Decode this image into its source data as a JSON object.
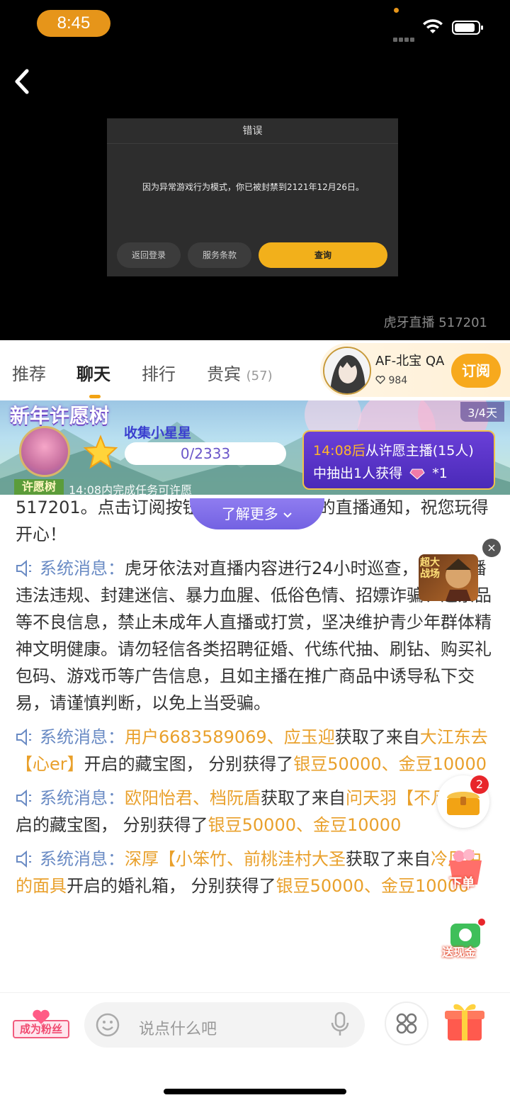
{
  "status_bar": {
    "time": "8:45"
  },
  "dialog": {
    "title": "错误",
    "message": "因为异常游戏行为模式，你已被封禁到2121年12月26日。",
    "buttons": {
      "back_login": "返回登录",
      "terms": "服务条款",
      "query": "查询"
    },
    "accent": "#f2b01b"
  },
  "video": {
    "watermark": "虎牙直播 517201"
  },
  "tabs": [
    {
      "label": "推荐"
    },
    {
      "label": "聊天"
    },
    {
      "label": "排行"
    },
    {
      "label": "贵宾",
      "count": "(57)"
    }
  ],
  "anchor": {
    "name": "AF-北宝 QA",
    "fans": "984",
    "subscribe_label": "订阅"
  },
  "banner": {
    "title": "新年许愿树",
    "days": "3/4天",
    "tree_label": "许愿树",
    "collect_label": "收集小星星",
    "progress_text": "0/2333",
    "task_note": "14:08内完成任务可许愿",
    "lottery_time": "14:08后",
    "lottery_line1_rest": "从许愿主播(15人)",
    "lottery_line2_pre": "中抽出1人获得",
    "lottery_line2_post": "*1",
    "learn_more": "了解更多"
  },
  "chat": {
    "partial_text": "517201。点击订阅按钮，即可收到主播的直播通知，祝您玩得开心！",
    "system_label": "系统消息：",
    "notice": "虎牙依法对直播内容进行24小时巡查，禁止传播违法违规、封建迷信、暴力血腥、低俗色情、招嫖诈骗、违禁品等不良信息，禁止未成年人直播或打赏，坚决维护青少年群体精神文明健康。请勿轻信各类招聘征婚、代练代抽、刷钻、购买礼包码、游戏币等广告信息，且如主播在推广商品中诱导私下交易，请谨慎判断，以免上当受骗。",
    "msg1": {
      "user_a": "用户6683589069",
      "sep": "、",
      "user_b": "应玉迎",
      "mid": "获取了来自",
      "source": "大江东去【心er】",
      "post": "开启的藏宝图， 分别获得了",
      "reward1": "银豆50000",
      "sep2": "、",
      "reward2": "金豆10000"
    },
    "msg2": {
      "user_a": "欧阳怡君",
      "sep": "、",
      "user_b": "档阮盾",
      "mid": "获取了来自",
      "source": "问天羽【不凡】",
      "post": "开启的藏宝图， 分别获得了",
      "reward1": "银豆50000",
      "sep2": "、",
      "reward2": "金豆10000"
    },
    "msg3": {
      "user_a": "深厚【小笨竹",
      "sep": "、",
      "user_b": "前桃洼村大圣",
      "mid": "获取了来自",
      "source": "冷风中的面具",
      "post": "开启的婚礼箱， 分别获得了",
      "reward1": "银豆50000",
      "sep2": "、",
      "reward2": "金豆10000"
    }
  },
  "floating": {
    "close_label": "×",
    "game_text": "超大战场",
    "chest_badge": "2",
    "order_label": "下单",
    "cash_label": "送现金"
  },
  "bottom": {
    "fan_label": "成为粉丝",
    "input_placeholder": "说点什么吧"
  }
}
